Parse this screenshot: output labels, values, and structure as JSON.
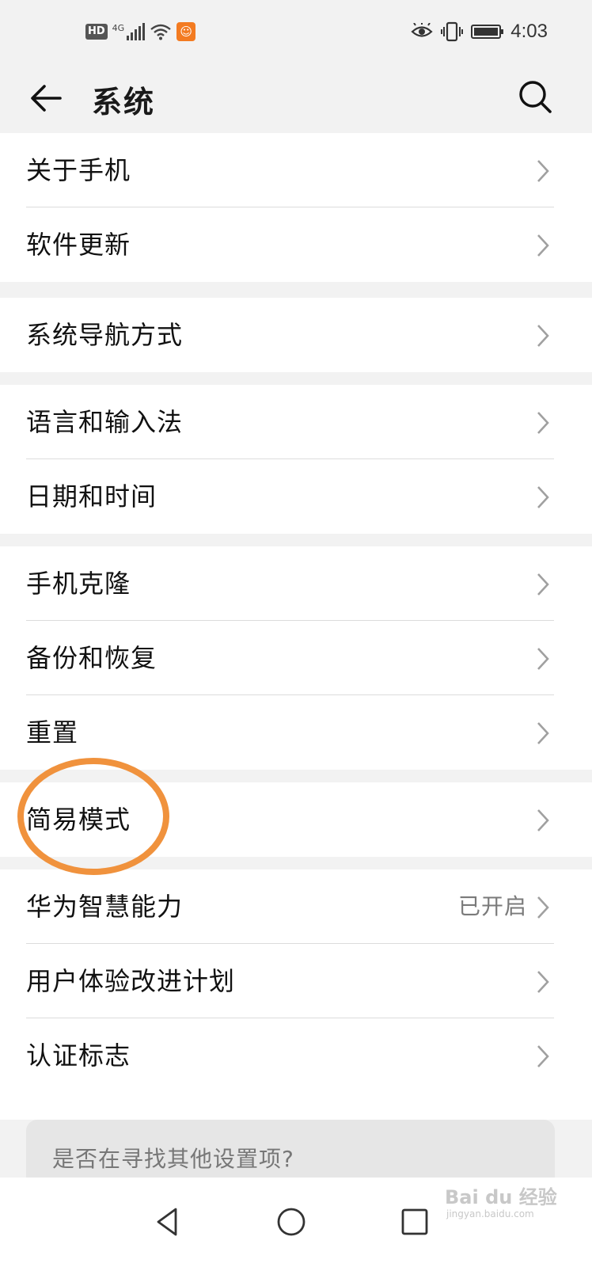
{
  "status_bar": {
    "hd_badge": "HD",
    "network_type": "4G",
    "time": "4:03",
    "icons": [
      "hd-icon",
      "signal-icon",
      "wifi-icon",
      "uc-browser-icon",
      "eye-comfort-icon",
      "vibrate-icon",
      "battery-icon"
    ]
  },
  "header": {
    "title": "系统"
  },
  "groups": [
    {
      "items": [
        {
          "label": "关于手机"
        },
        {
          "label": "软件更新"
        }
      ]
    },
    {
      "items": [
        {
          "label": "系统导航方式"
        }
      ]
    },
    {
      "items": [
        {
          "label": "语言和输入法"
        },
        {
          "label": "日期和时间"
        }
      ]
    },
    {
      "items": [
        {
          "label": "手机克隆"
        },
        {
          "label": "备份和恢复"
        },
        {
          "label": "重置"
        }
      ]
    },
    {
      "items": [
        {
          "label": "简易模式"
        }
      ]
    },
    {
      "items": [
        {
          "label": "华为智慧能力",
          "value": "已开启"
        },
        {
          "label": "用户体验改进计划"
        },
        {
          "label": "认证标志"
        }
      ]
    }
  ],
  "other_settings": {
    "text": "是否在寻找其他设置项?"
  },
  "annotation": {
    "color": "#f0923d",
    "target": "简易模式"
  },
  "watermark": {
    "brand": "Bai du 经验",
    "url": "jingyan.baidu.com"
  }
}
